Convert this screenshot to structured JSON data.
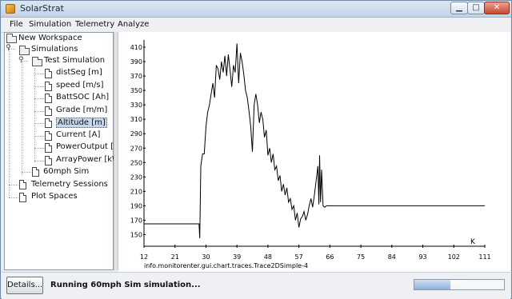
{
  "window": {
    "title": "SolarStrat",
    "minimize_glyph": "▁",
    "maximize_glyph": "□",
    "close_glyph": "✕"
  },
  "menu": [
    "File",
    "Simulation",
    "Telemetry",
    "Analyze"
  ],
  "tree": {
    "root": "New Workspace",
    "simulations": "Simulations",
    "test_simulation": "Test Simulation",
    "traces": [
      "distSeg [m]",
      "speed [m/s]",
      "BattSOC [Ah]",
      "Grade [m/m]",
      "Altitude [m]",
      "Current [A]",
      "PowerOutput [W]",
      "ArrayPower [kW]"
    ],
    "selected_trace": "Altitude [m]",
    "sim2": "60mph Sim",
    "telemetry_sessions": "Telemetry Sessions",
    "plot_spaces": "Plot Spaces"
  },
  "status": {
    "details_label": "Details...",
    "message": "Running 60mph Sim simulation...",
    "progress_label": "40%",
    "progress": 0.4
  },
  "colors": {
    "progress_fill": "#8fb0d8",
    "selection": "#c7d6ea"
  },
  "chart_data": {
    "type": "line",
    "xlabel": "",
    "x_unit_label": "K",
    "trace_label": "info.monitorenter.gui.chart.traces.Trace2DSimple-4",
    "xlim": [
      12,
      111
    ],
    "ylim": [
      145,
      420
    ],
    "xticks": [
      12,
      21,
      30,
      39,
      48,
      57,
      66,
      75,
      84,
      93,
      102,
      111
    ],
    "yticks": [
      150,
      170,
      190,
      210,
      230,
      250,
      270,
      290,
      310,
      330,
      350,
      370,
      390,
      410
    ],
    "series": [
      {
        "x": [
          12,
          28,
          28.2,
          28.5,
          29,
          29.5,
          30,
          30.5,
          31,
          31.5,
          32,
          32.5,
          33,
          33.5,
          34,
          34.5,
          35,
          35.5,
          36,
          36.5,
          37,
          37.5,
          38,
          38.5,
          39,
          39.5,
          40,
          40.5,
          41,
          41.5,
          42,
          42.5,
          43,
          43.5,
          44,
          44.5,
          45,
          45.5,
          46,
          46.5,
          47,
          47.5,
          48,
          48.5,
          49,
          49.5,
          50,
          50.5,
          51,
          51.5,
          52,
          52.5,
          53,
          53.5,
          54,
          54.5,
          55,
          55.5,
          56,
          56.5,
          57,
          57.5,
          58,
          58.5,
          59,
          59.5,
          60,
          60.5,
          61,
          61.5,
          62,
          62.5,
          62.8,
          63,
          63.3,
          63.6,
          64,
          64.5,
          65,
          111
        ],
        "y": [
          165,
          165,
          145,
          245,
          262,
          262,
          300,
          320,
          330,
          345,
          360,
          340,
          385,
          380,
          365,
          390,
          375,
          398,
          370,
          400,
          378,
          355,
          385,
          375,
          415,
          360,
          402,
          390,
          372,
          350,
          340,
          322,
          300,
          265,
          330,
          345,
          330,
          305,
          320,
          310,
          285,
          295,
          260,
          270,
          250,
          262,
          240,
          245,
          225,
          232,
          210,
          220,
          205,
          215,
          195,
          200,
          185,
          190,
          170,
          180,
          160,
          172,
          175,
          182,
          170,
          178,
          190,
          200,
          188,
          205,
          225,
          245,
          192,
          260,
          195,
          240,
          190,
          188,
          190,
          190
        ]
      }
    ]
  }
}
